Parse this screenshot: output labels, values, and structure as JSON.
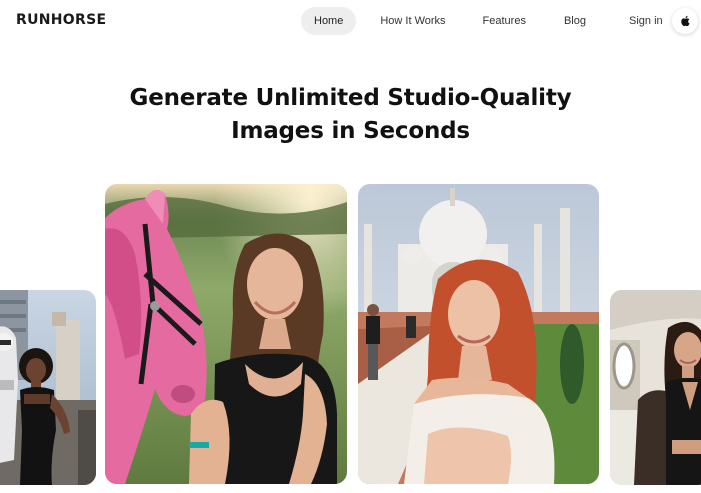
{
  "brand": {
    "logo_text": "RUNHORSE"
  },
  "nav": {
    "items": [
      {
        "label": "Home",
        "active": true
      },
      {
        "label": "How It Works",
        "active": false
      },
      {
        "label": "Features",
        "active": false
      },
      {
        "label": "Blog",
        "active": false
      },
      {
        "label": "Sign in",
        "active": false
      }
    ],
    "apple_icon": "apple-icon"
  },
  "hero": {
    "title_line1": "Generate Unlimited Studio-Quality",
    "title_line2": "Images in Seconds"
  },
  "gallery": {
    "cards": [
      {
        "scene": "woman in black dress beside a robot in a city"
      },
      {
        "scene": "smiling woman with a pink horse in a field"
      },
      {
        "scene": "red-haired woman in front of a white domed palace"
      },
      {
        "scene": "woman in a private jet cabin"
      }
    ]
  },
  "colors": {
    "active_nav_bg": "#eeeeee",
    "text": "#111111",
    "background": "#ffffff"
  }
}
